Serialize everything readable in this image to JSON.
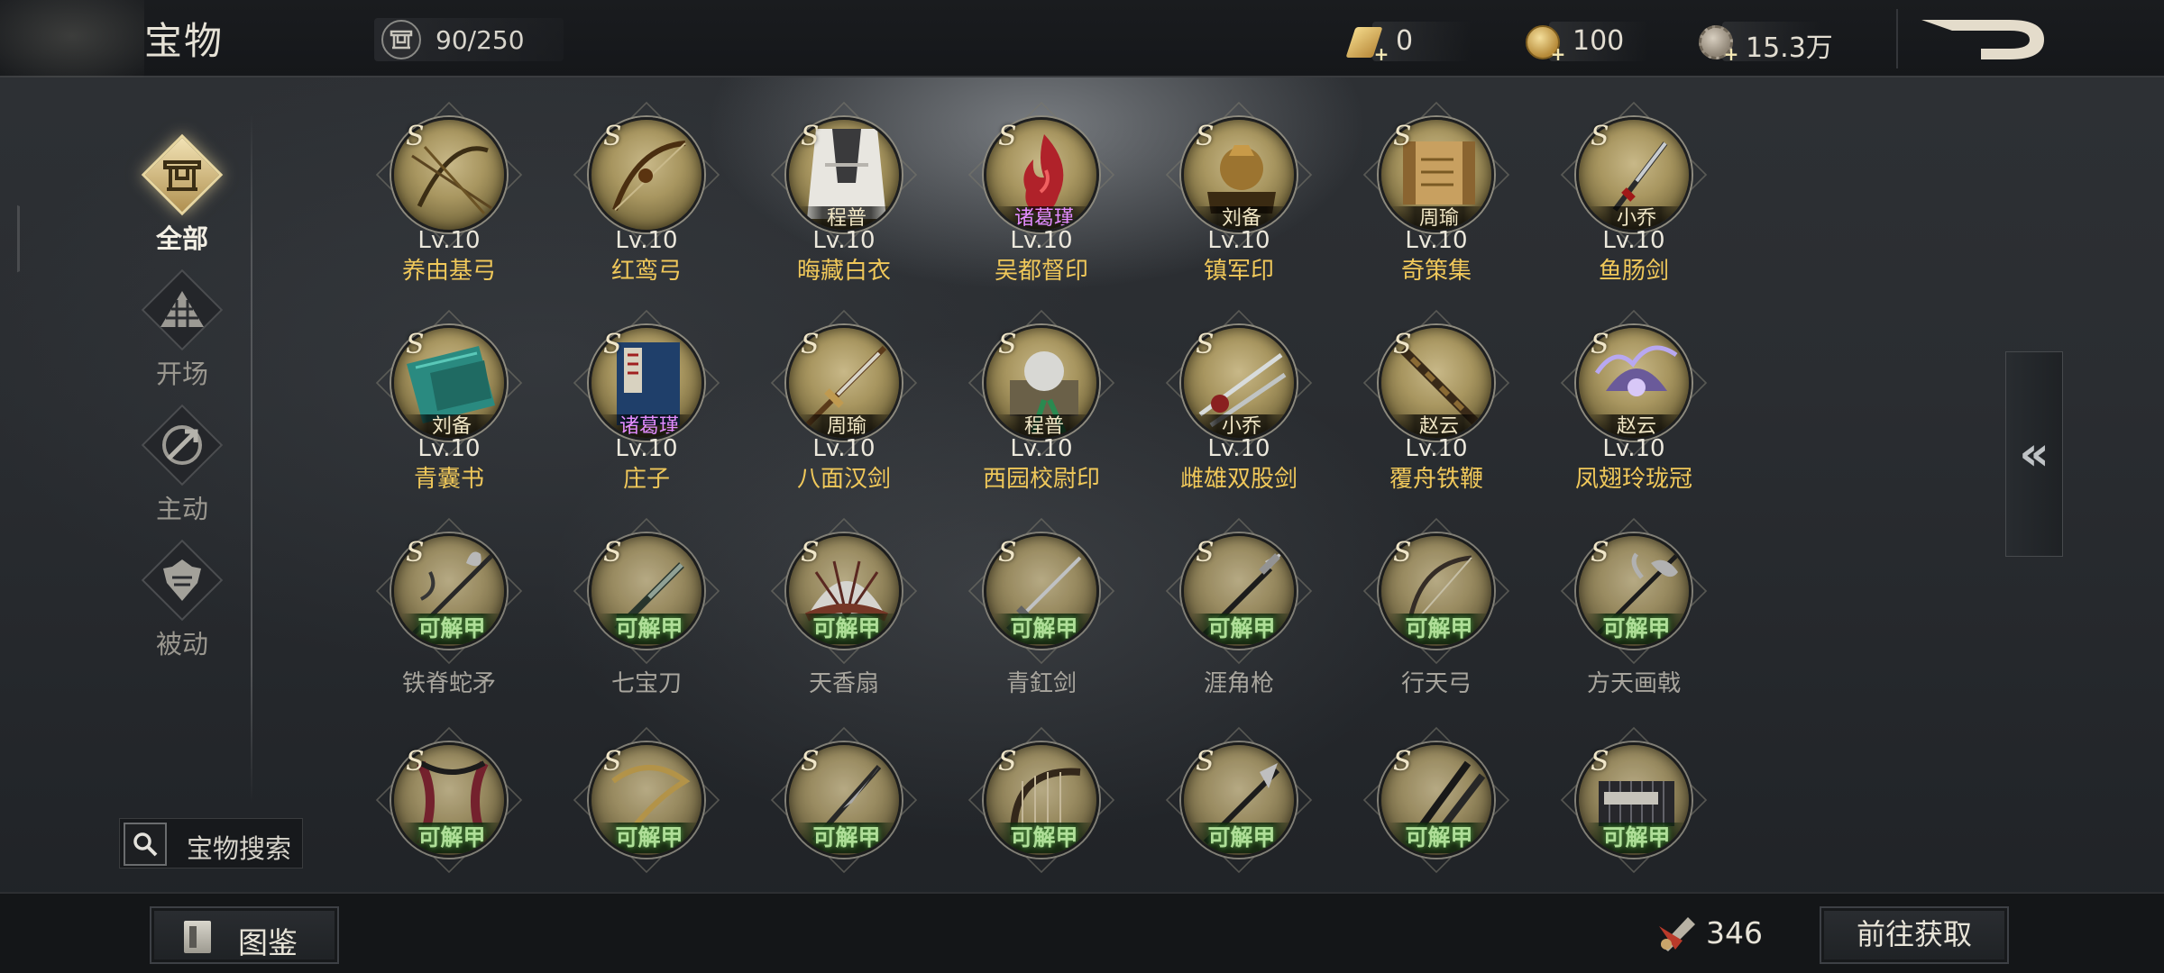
{
  "header": {
    "title": "宝物",
    "capacity": "90/250",
    "currencies": [
      {
        "name": "gold-ingot",
        "value": "0"
      },
      {
        "name": "gold-coin",
        "value": "100"
      },
      {
        "name": "copper-coin",
        "value": "15.3万"
      }
    ]
  },
  "sidebar": {
    "items": [
      {
        "label": "全部",
        "icon": "altar-icon",
        "active": true
      },
      {
        "label": "开场",
        "icon": "formation-icon",
        "active": false
      },
      {
        "label": "主动",
        "icon": "active-skill-icon",
        "active": false
      },
      {
        "label": "被动",
        "icon": "armor-icon",
        "active": false
      }
    ],
    "search_label": "宝物搜索"
  },
  "grid": {
    "rank_mark": "S",
    "rows": [
      [
        {
          "level": "Lv.10",
          "name": "养由基弓",
          "owner": "",
          "art": "bow"
        },
        {
          "level": "Lv.10",
          "name": "红鸾弓",
          "owner": "",
          "art": "bow2"
        },
        {
          "level": "Lv.10",
          "name": "晦藏白衣",
          "owner": "程普",
          "art": "cloak"
        },
        {
          "level": "Lv.10",
          "name": "吴都督印",
          "owner": "诸葛瑾",
          "art": "flame"
        },
        {
          "level": "Lv.10",
          "name": "镇军印",
          "owner": "刘备",
          "art": "seal"
        },
        {
          "level": "Lv.10",
          "name": "奇策集",
          "owner": "周瑜",
          "art": "scroll"
        },
        {
          "level": "Lv.10",
          "name": "鱼肠剑",
          "owner": "小乔",
          "art": "dagger"
        }
      ],
      [
        {
          "level": "Lv.10",
          "name": "青囊书",
          "owner": "刘备",
          "art": "book-teal"
        },
        {
          "level": "Lv.10",
          "name": "庄子",
          "owner": "诸葛瑾",
          "art": "book-blue"
        },
        {
          "level": "Lv.10",
          "name": "八面汉剑",
          "owner": "周瑜",
          "art": "sword"
        },
        {
          "level": "Lv.10",
          "name": "西园校尉印",
          "owner": "程普",
          "art": "seal2"
        },
        {
          "level": "Lv.10",
          "name": "雌雄双股剑",
          "owner": "小乔",
          "art": "twin"
        },
        {
          "level": "Lv.10",
          "name": "覆舟铁鞭",
          "owner": "赵云",
          "art": "whip"
        },
        {
          "level": "Lv.10",
          "name": "凤翅玲珑冠",
          "owner": "赵云",
          "art": "crown"
        }
      ],
      [
        {
          "name": "铁脊蛇矛",
          "status": "可解甲",
          "art": "spear"
        },
        {
          "name": "七宝刀",
          "status": "可解甲",
          "art": "blade"
        },
        {
          "name": "天香扇",
          "status": "可解甲",
          "art": "fan"
        },
        {
          "name": "青釭剑",
          "status": "可解甲",
          "art": "sword2"
        },
        {
          "name": "涯角枪",
          "status": "可解甲",
          "art": "spear2"
        },
        {
          "name": "行天弓",
          "status": "可解甲",
          "art": "bow3"
        },
        {
          "name": "方天画戟",
          "status": "可解甲",
          "art": "halberd"
        }
      ],
      [
        {
          "name": "",
          "status": "可解甲",
          "art": "ribbon"
        },
        {
          "name": "",
          "status": "可解甲",
          "art": "chain"
        },
        {
          "name": "",
          "status": "可解甲",
          "art": "broadsword"
        },
        {
          "name": "",
          "status": "可解甲",
          "art": "harp"
        },
        {
          "name": "",
          "status": "可解甲",
          "art": "glaive"
        },
        {
          "name": "",
          "status": "可解甲",
          "art": "sticks"
        },
        {
          "name": "",
          "status": "可解甲",
          "art": "slips"
        }
      ]
    ]
  },
  "footer": {
    "atlas_label": "图鉴",
    "token_count": "346",
    "obtain_label": "前往获取"
  },
  "colors": {
    "item_name_unlocked": "#f0c85a",
    "item_name_locked": "#a8a59d",
    "lock_tag": "#b8f59b",
    "owner_purple": "#e38cff"
  }
}
